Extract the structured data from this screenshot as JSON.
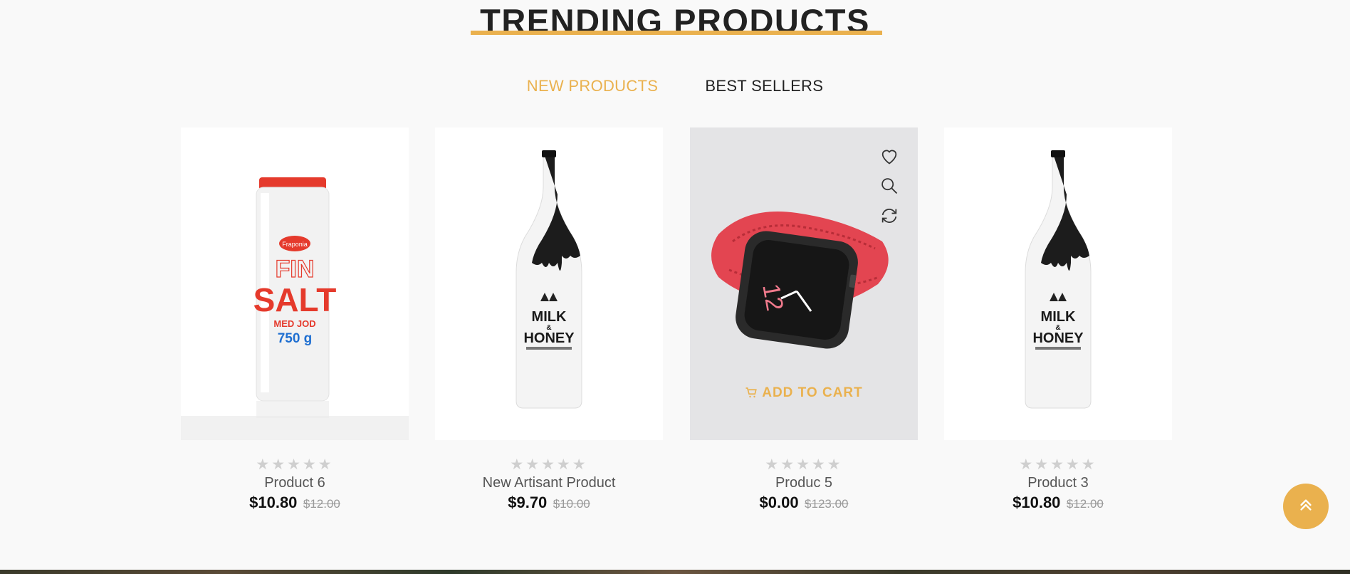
{
  "section": {
    "title": "TRENDING PRODUCTS"
  },
  "tabs": [
    {
      "label": "NEW PRODUCTS",
      "active": true
    },
    {
      "label": "BEST SELLERS",
      "active": false
    }
  ],
  "colors": {
    "accent": "#eab14e",
    "text": "#222222",
    "background": "#f9f9f9"
  },
  "products": [
    {
      "name": "Product 6",
      "price": "$10.80",
      "old_price": "$12.00",
      "rating": 0,
      "stars": "★★★★★",
      "image": "salt-container"
    },
    {
      "name": "New Artisant Product",
      "price": "$9.70",
      "old_price": "$10.00",
      "rating": 0,
      "stars": "★★★★★",
      "image": "milk-honey-bottle"
    },
    {
      "name": "Produc 5",
      "price": "$0.00",
      "old_price": "$123.00",
      "rating": 0,
      "stars": "★★★★★",
      "image": "smartwatch-red-band",
      "hover": true,
      "add_to_cart": "ADD TO CART"
    },
    {
      "name": "Product 3",
      "price": "$10.80",
      "old_price": "$12.00",
      "rating": 0,
      "stars": "★★★★★",
      "image": "milk-honey-bottle"
    }
  ],
  "product_image_text": {
    "salt": {
      "brand": "Fraponia",
      "line1": "FIN",
      "line2": "SALT",
      "line3": "MED JOD",
      "line4": "750 g"
    },
    "bottle": {
      "line1": "MILK",
      "line2": "&",
      "line3": "HONEY"
    },
    "watch": {
      "face": "12"
    }
  },
  "icons": {
    "wishlist": "heart-icon",
    "quickview": "search-icon",
    "compare": "refresh-icon",
    "cart": "cart-icon",
    "back_to_top": "chevron-double-up-icon"
  }
}
